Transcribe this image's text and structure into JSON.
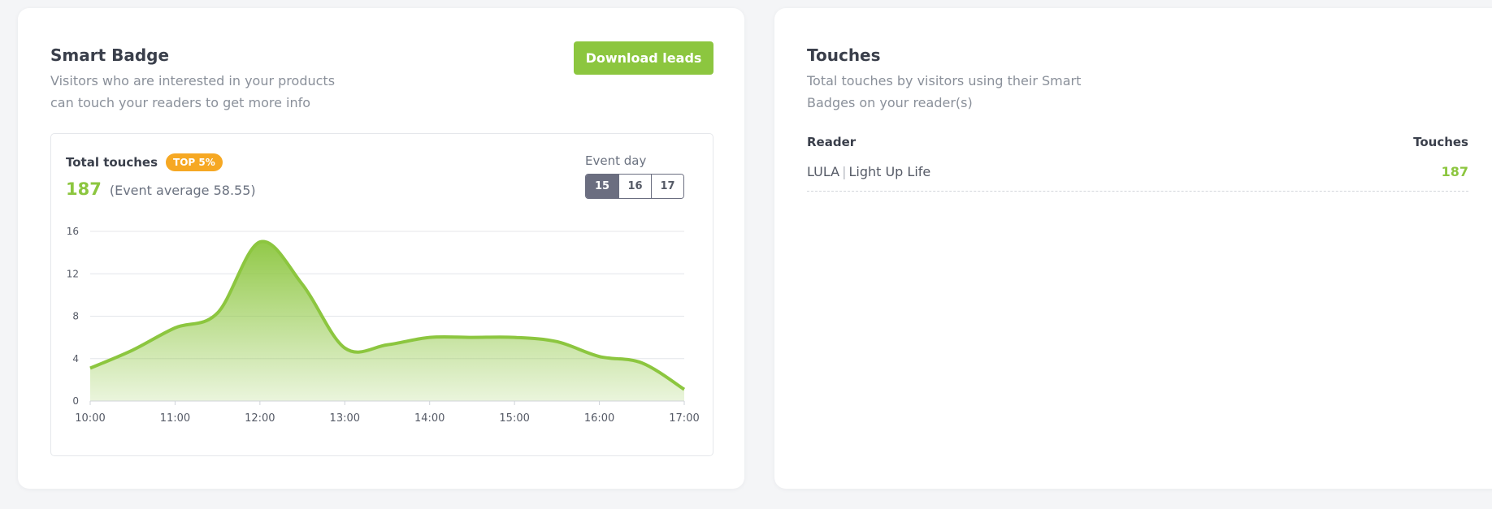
{
  "smart_badge": {
    "title": "Smart Badge",
    "subtitle_lines": [
      "Visitors who are interested in your products",
      "can touch your readers to get more info"
    ],
    "download_button": "Download leads",
    "total_touches_label": "Total touches",
    "rank_badge": "TOP 5%",
    "total_value": "187",
    "event_average": "(Event average 58.55)",
    "event_day_label": "Event day",
    "days": [
      "15",
      "16",
      "17"
    ],
    "selected_day": "15"
  },
  "chart_data": {
    "type": "area",
    "x": [
      "10:00",
      "11:00",
      "12:00",
      "13:00",
      "14:00",
      "15:00",
      "16:00",
      "17:00"
    ],
    "x_fine": [
      10.0,
      10.5,
      11.0,
      11.5,
      12.0,
      12.5,
      13.0,
      13.5,
      14.0,
      14.5,
      15.0,
      15.5,
      16.0,
      16.5,
      17.0
    ],
    "y_fine": [
      3.1,
      4.8,
      6.9,
      8.3,
      15.0,
      11.0,
      5.0,
      5.3,
      6.0,
      6.0,
      6.0,
      5.6,
      4.2,
      3.6,
      1.1
    ],
    "yticks": [
      0,
      4,
      8,
      12,
      16
    ],
    "ylim": [
      0,
      16
    ],
    "xlim": [
      10,
      17
    ],
    "grid": true,
    "color": "#8cc63f"
  },
  "touches": {
    "title": "Touches",
    "subtitle_lines": [
      "Total touches by visitors using their Smart",
      "Badges on your reader(s)"
    ],
    "col_reader": "Reader",
    "col_touches": "Touches",
    "rows": [
      {
        "reader_a": "LULA",
        "separator": "|",
        "reader_b": "Light Up Life",
        "touches": "187"
      }
    ]
  },
  "colors": {
    "accent_green": "#8cc63f",
    "badge_orange": "#f6a823",
    "selected_day": "#6b6e80"
  }
}
